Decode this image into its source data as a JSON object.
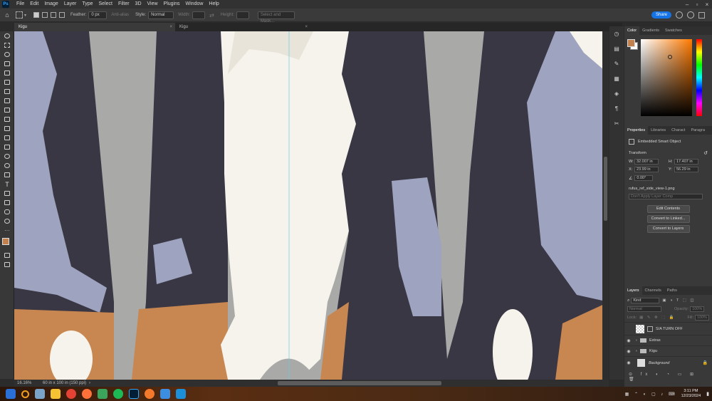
{
  "app": {
    "logo": "Ps"
  },
  "menu": {
    "items": [
      "File",
      "Edit",
      "Image",
      "Layer",
      "Type",
      "Select",
      "Filter",
      "3D",
      "View",
      "Plugins",
      "Window",
      "Help"
    ]
  },
  "options": {
    "feather_label": "Feather:",
    "feather_value": "0 px",
    "antialias_label": "Anti-alias",
    "style_label": "Style:",
    "style_value": "Normal",
    "width_label": "Width:",
    "height_label": "Height:",
    "select_mask_label": "Select and Mask...",
    "share_label": "Share"
  },
  "tabs": [
    {
      "label": "Kigu"
    },
    {
      "label": "Kigu"
    }
  ],
  "status": {
    "zoom": "16.16%",
    "doc_info": "60 in x 100 in (150 ppi)"
  },
  "color_panel": {
    "tabs": [
      "Color",
      "Gradients",
      "Swatches"
    ],
    "foreground": "#c2814e",
    "background": "#ffffff"
  },
  "properties": {
    "tabs": [
      "Properties",
      "Libraries",
      "Charact",
      "Paragra"
    ],
    "object_type": "Embedded Smart Object",
    "transform_label": "Transform",
    "w_label": "W:",
    "w_value": "32.007 in",
    "h_label": "H:",
    "h_value": "17.407 in",
    "x_label": "X:",
    "x_value": "23.99 in",
    "y_label": "Y:",
    "y_value": "56.29 in",
    "angle_value": "0.00°",
    "filename": "rufus_ref_side_view-1.png",
    "layer_comp_placeholder": "Don't Apply Layer Comp",
    "buttons": [
      "Edit Contents",
      "Convert to Linked...",
      "Convert to Layers"
    ]
  },
  "layers": {
    "tabs": [
      "Layers",
      "Channels",
      "Paths"
    ],
    "kind_label": "Kind",
    "blend_mode": "Normal",
    "opacity_label": "Opacity:",
    "opacity_value": "100%",
    "lock_label": "Lock:",
    "fill_label": "Fill:",
    "fill_value": "100%",
    "items": [
      {
        "name": "S/A TURN OFF",
        "visible": false
      },
      {
        "name": "Extras",
        "visible": true
      },
      {
        "name": "Kigu",
        "visible": true
      },
      {
        "name": "Background",
        "visible": true
      }
    ]
  },
  "taskbar": {
    "time": "3:11 PM",
    "date": "12/23/2024"
  }
}
